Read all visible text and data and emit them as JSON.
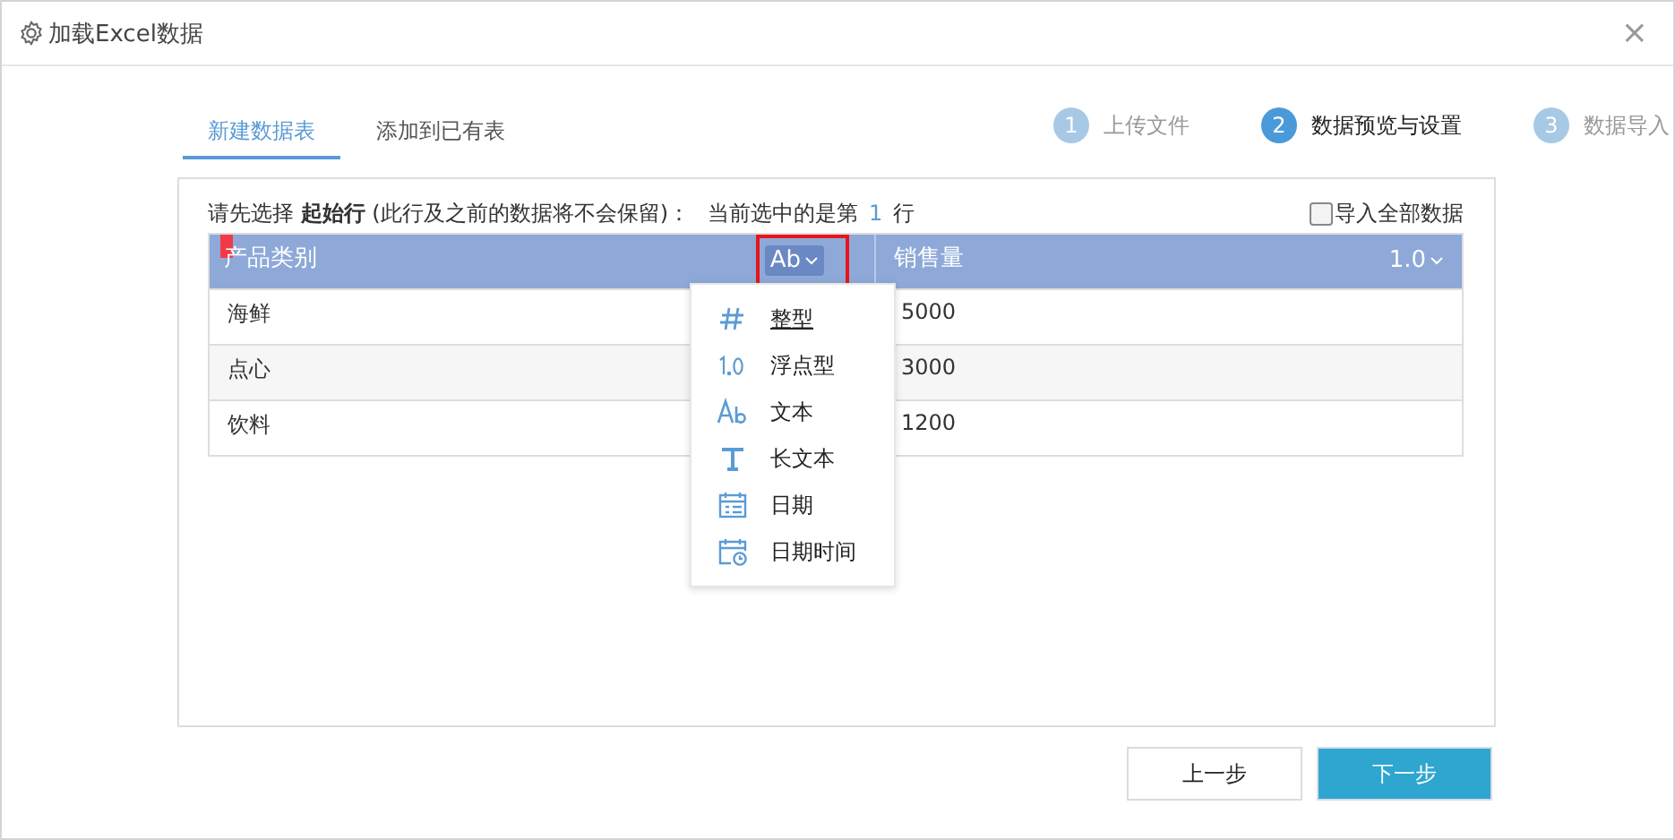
{
  "window": {
    "title": "加载Excel数据",
    "close": "×"
  },
  "tabs": [
    {
      "label": "新建数据表",
      "selected": true
    },
    {
      "label": "添加到已有表",
      "selected": false
    }
  ],
  "steps": [
    {
      "number": "1",
      "label": "上传文件",
      "selected": false
    },
    {
      "number": "2",
      "label": "数据预览与设置",
      "selected": true
    },
    {
      "number": "3",
      "label": "数据导入",
      "selected": false
    }
  ],
  "instruction": "请先选择 **起始行** (此行及之前的数据将不会保留)：",
  "current_row": {
    "prefix": "当前选中的是第",
    "number": "1",
    "suffix": "行"
  },
  "import_all": {
    "label": "导入全部数据",
    "checked": false
  },
  "table": {
    "columns": [
      {
        "name": "产品类别",
        "type_label": "Ab",
        "menu_open": true
      },
      {
        "name": "销售量",
        "type_label": "1.0",
        "menu_open": false
      }
    ],
    "header_selected": true,
    "rows": [
      {
        "cells": [
          "海鲜",
          "5000"
        ]
      },
      {
        "cells": [
          "点心",
          "3000"
        ]
      },
      {
        "cells": [
          "饮料",
          "1200"
        ]
      }
    ]
  },
  "type_menu": [
    {
      "kind": "int",
      "label": "整型",
      "selected": true
    },
    {
      "kind": "float",
      "label": "浮点型",
      "selected": false
    },
    {
      "kind": "text",
      "label": "文本",
      "selected": false
    },
    {
      "kind": "longtext",
      "label": "长文本",
      "selected": false
    },
    {
      "kind": "date",
      "label": "日期",
      "selected": false
    },
    {
      "kind": "datetime",
      "label": "日期时间",
      "selected": false
    }
  ],
  "buttons": [
    {
      "kind": "secondary",
      "label": "上一步"
    },
    {
      "kind": "primary",
      "label": "下一步"
    }
  ]
}
